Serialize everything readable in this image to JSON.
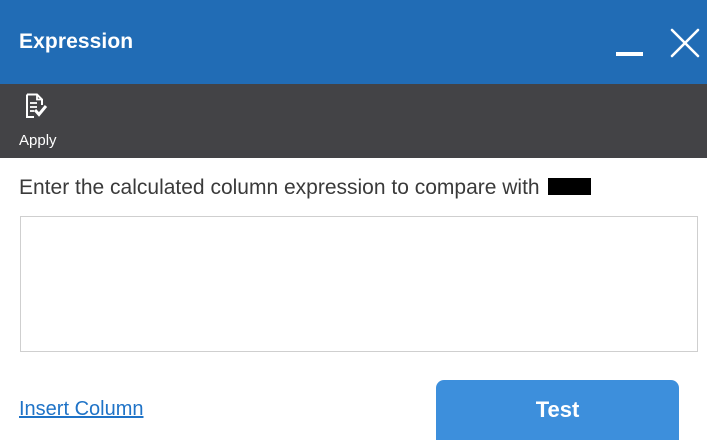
{
  "window": {
    "title": "Expression",
    "minimize_icon": "minimize-icon",
    "close_icon": "close-icon"
  },
  "toolbar": {
    "apply_label": "Apply",
    "apply_icon": "document-check-icon"
  },
  "main": {
    "prompt_text": "Enter the calculated column expression to compare with",
    "expression_value": "",
    "insert_column_label": "Insert Column",
    "test_label": "Test"
  },
  "colors": {
    "titlebar": "#216cb5",
    "toolbar": "#434346",
    "accent_button": "#3d8fdc",
    "link": "#1f73c7"
  }
}
